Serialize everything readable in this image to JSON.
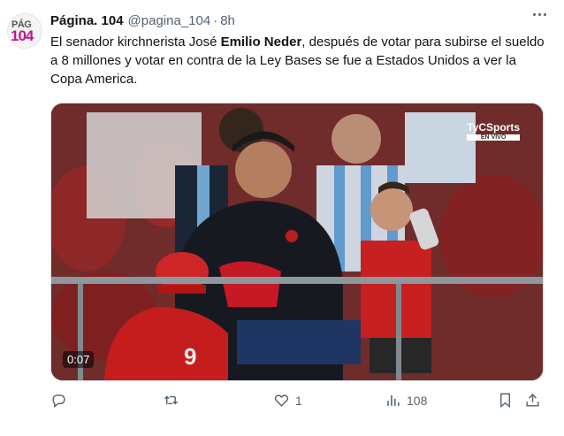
{
  "tweet": {
    "author_name": "Página. 104",
    "handle": "@pagina_104",
    "separator": "·",
    "time": "8h",
    "avatar_text_top": "PÁG",
    "avatar_text_bottom": "104",
    "text_part1": "El senador kirchnerista José ",
    "text_bold": "Emilio Neder",
    "text_part2": ", después de votar para subirse el sueldo a 8 millones y votar en contra de la Ley Bases se fue a Estados Unidos a ver la Copa America."
  },
  "media": {
    "timestamp": "0:07",
    "broadcaster": "TyCSports",
    "broadcaster_sub": "EN VIVO"
  },
  "actions": {
    "reply_count": "",
    "retweet_count": "",
    "like_count": "1",
    "views_count": "108"
  },
  "icons": {
    "more": "more-dots-icon",
    "reply": "reply-icon",
    "retweet": "retweet-icon",
    "like": "heart-icon",
    "views": "views-icon",
    "bookmark": "bookmark-icon",
    "share": "share-icon"
  }
}
